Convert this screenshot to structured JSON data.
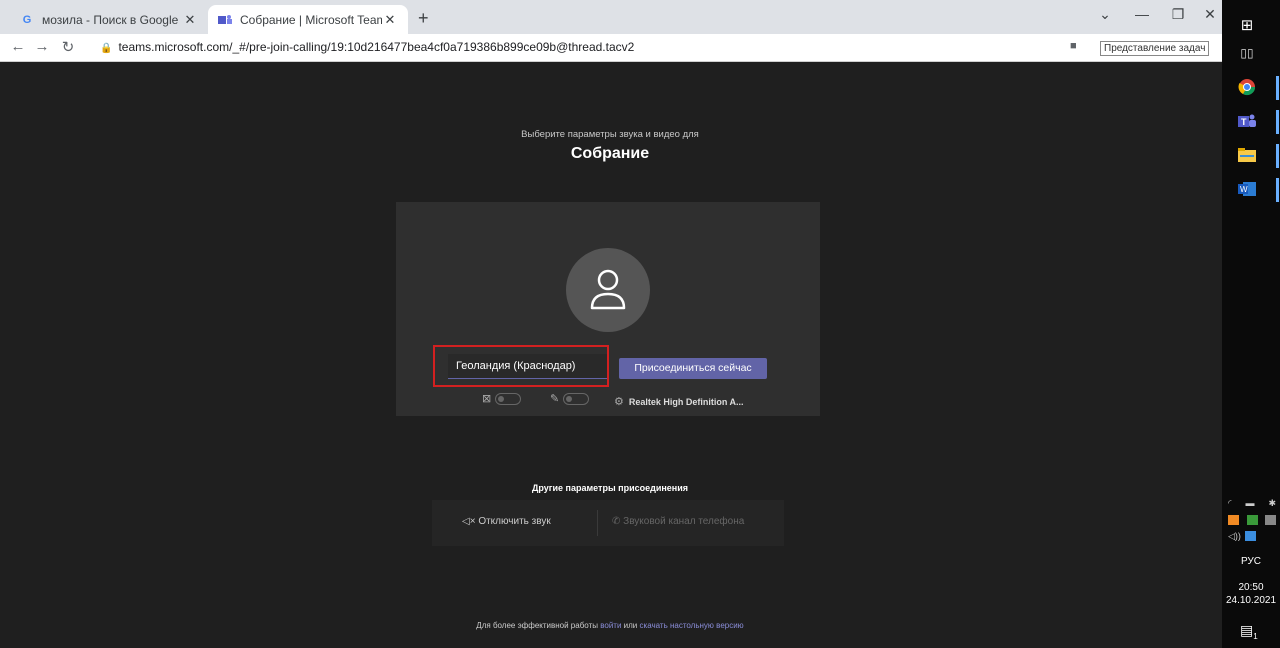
{
  "browser": {
    "tabs": [
      {
        "label": "мозила - Поиск в Google",
        "favicon": "G",
        "active": false
      },
      {
        "label": "Собрание | Microsoft Teams",
        "favicon": "teams",
        "active": true
      }
    ],
    "new_tab": "+",
    "url": "teams.microsoft.com/_#/pre-join-calling/19:10d216477bea4cf0a719386b899ce09b@thread.tacv2",
    "tooltip": "Представление задач"
  },
  "teams": {
    "subtitle": "Выберите параметры звука и видео для",
    "meeting_title": "Собрание",
    "name_value": "Геоландия (Краснодар)",
    "join_button": "Присоединиться сейчас",
    "device": "Realtek High Definition A...",
    "other_options_title": "Другие параметры присоединения",
    "mute_option": "Отключить звук",
    "phone_option": "Звуковой канал телефона",
    "footer_prefix": "Для более эффективной работы",
    "footer_login": "войти",
    "footer_or": "или",
    "footer_download": "скачать настольную версию"
  },
  "taskbar": {
    "language": "РУС",
    "time": "20:50",
    "date": "24.10.2021",
    "notification_count": "1"
  },
  "colors": {
    "accent": "#6264a7",
    "highlight": "#d32020",
    "background": "#1f1f1f"
  }
}
